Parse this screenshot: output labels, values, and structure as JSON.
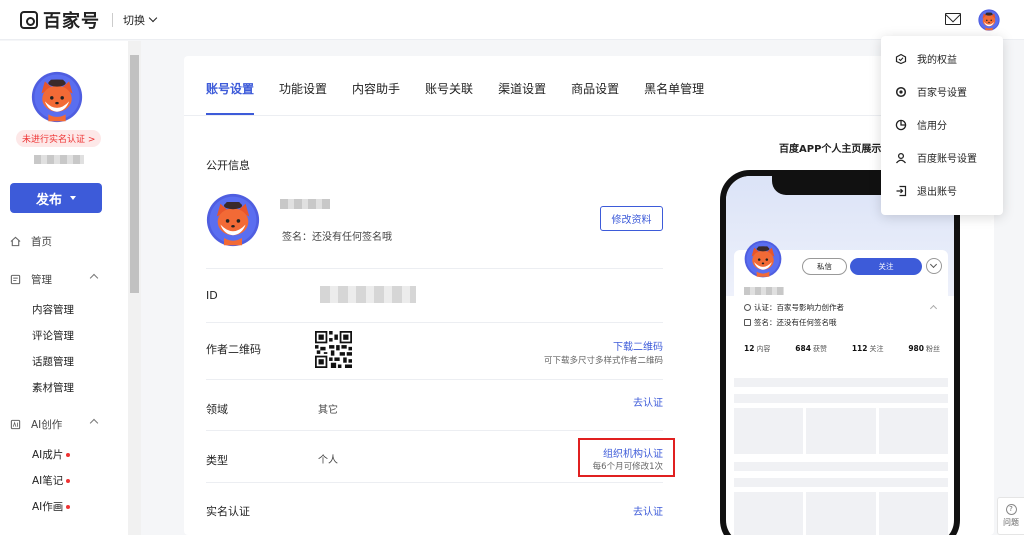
{
  "header": {
    "logo_text": "百家号",
    "switch_label": "切换",
    "mail_icon": "mail-icon"
  },
  "sidebar": {
    "verify_tag": "未进行实名认证 >",
    "publish_label": "发布",
    "home_label": "首页",
    "manage_label": "管理",
    "manage_items": [
      "内容管理",
      "评论管理",
      "话题管理",
      "素材管理"
    ],
    "ai_label": "AI创作",
    "ai_items": [
      "AI成片",
      "AI笔记",
      "AI作画"
    ]
  },
  "tabs": [
    "账号设置",
    "功能设置",
    "内容助手",
    "账号关联",
    "渠道设置",
    "商品设置",
    "黑名单管理"
  ],
  "active_tab": "账号设置",
  "public_info": {
    "section_title": "公开信息",
    "signature": "签名：还没有任何签名哦",
    "edit_button": "修改资料"
  },
  "rows": {
    "id_label": "ID",
    "qr_label": "作者二维码",
    "qr_link": "下载二维码",
    "qr_hint": "可下载多尺寸多样式作者二维码",
    "field_label": "领域",
    "field_value": "其它",
    "field_link": "去认证",
    "type_label": "类型",
    "type_value": "个人",
    "type_link": "组织机构认证",
    "type_hint": "每6个月可修改1次",
    "realname_label": "实名认证",
    "realname_link": "去认证"
  },
  "preview": {
    "title": "百度APP个人主页展示",
    "msg_button": "私信",
    "follow_button": "关注",
    "cert_text": "认证：百家号影响力创作者",
    "sign_text": "签名：还没有任何签名哦",
    "stats": [
      {
        "num": "12",
        "label": "内容"
      },
      {
        "num": "684",
        "label": "获赞"
      },
      {
        "num": "112",
        "label": "关注"
      },
      {
        "num": "980",
        "label": "粉丝"
      }
    ]
  },
  "menu": {
    "items": [
      "我的权益",
      "百家号设置",
      "信用分",
      "百度账号设置",
      "退出账号"
    ]
  },
  "float_help": "问题",
  "colors": {
    "accent": "#3d5bd9",
    "alert": "#e02020"
  }
}
